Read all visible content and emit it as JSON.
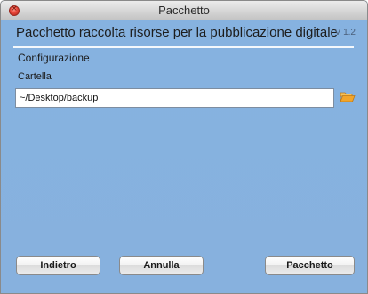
{
  "window": {
    "title": "Pacchetto",
    "close_glyph": "×"
  },
  "header": {
    "title": "Pacchetto raccolta risorse per la pubblicazione digitale",
    "version": "V 1.2"
  },
  "section": {
    "label": "Configurazione"
  },
  "folder": {
    "label": "Cartella",
    "value": "~/Desktop/backup",
    "browse_icon": "folder-open-icon"
  },
  "buttons": {
    "back_label": "Indietro",
    "cancel_label": "Annulla",
    "package_label": "Pacchetto"
  },
  "colors": {
    "background": "#86b1df",
    "divider": "#f4f8fc",
    "folder_icon": "#e8a22a"
  }
}
